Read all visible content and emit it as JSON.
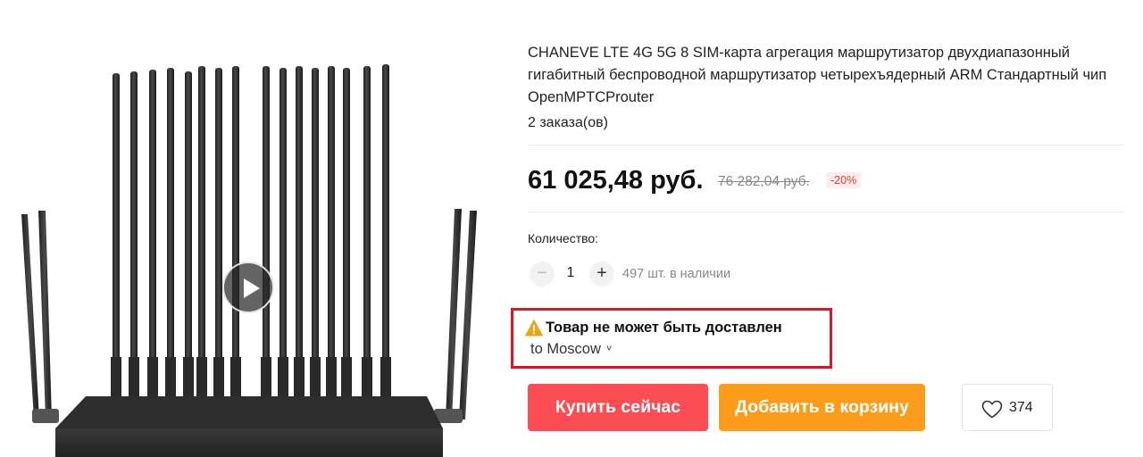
{
  "product": {
    "title": "CHANEVE LTE 4G 5G 8 SIM-карта агрегация маршрутизатор двухдиапазонный гигабитный беспроводной маршрутизатор четырехъядерный ARM Стандартный чип OpenMPTCProuter",
    "orders": "2 заказа(ов)"
  },
  "price": {
    "current": "61 025,48 руб.",
    "old": "76 282,04 руб.",
    "discount": "-20%"
  },
  "quantity": {
    "label": "Количество:",
    "value": "1",
    "minus": "−",
    "plus": "+",
    "stock": "497 шт. в наличии"
  },
  "shipping": {
    "warning": "Товар не может быть доставлен",
    "destination": "to Moscow",
    "chevron": "˅",
    "warn_color": "#f0a20a",
    "highlight_color": "#e3131f"
  },
  "actions": {
    "buy": "Купить сейчас",
    "cart": "Добавить в корзину",
    "wishlist_count": "374",
    "buy_color": "#fc4d55",
    "cart_color": "#fd9b1b"
  },
  "gallery": {
    "play_icon": "play-icon"
  }
}
